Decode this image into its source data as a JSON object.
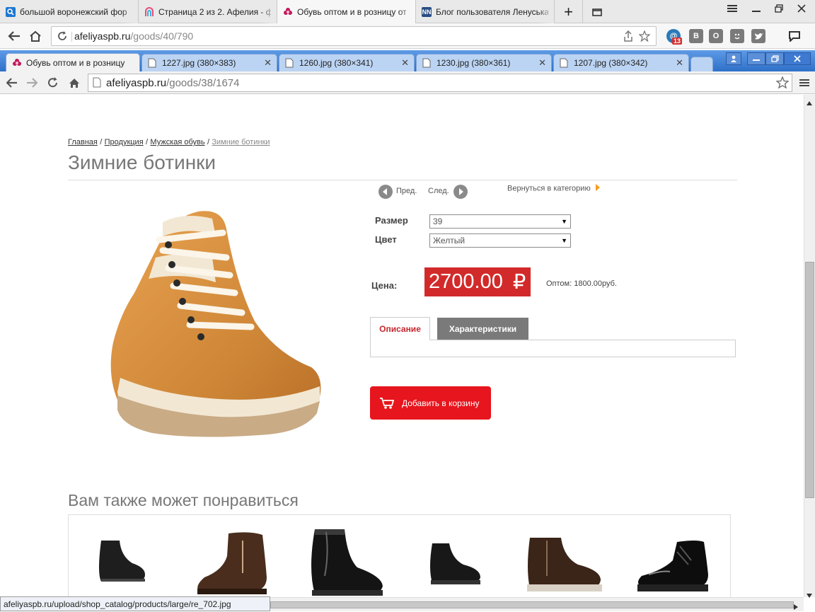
{
  "outer_browser": {
    "tabs": [
      {
        "title": "большой воронежский фор",
        "favicon_color": "#1f78d1"
      },
      {
        "title": "Страница 2 из 2. Афелия - ф",
        "favicon_color": "#e94e77"
      },
      {
        "title": "Обувь оптом и в розницу от",
        "favicon_color": "#c2185b"
      },
      {
        "title": "Блог пользователя Ленуська",
        "favicon_color": "#2a4d84",
        "favicon_text": "NN"
      }
    ],
    "new_tab_symbol": "+",
    "url_host": "afeliyaspb.ru",
    "url_path": "/goods/40/790",
    "badge_count": "13",
    "ext_letters": {
      "vk": "В",
      "ok": "О"
    }
  },
  "inner_browser": {
    "tabs": [
      {
        "title": "Обувь оптом и в розницу"
      },
      {
        "title": "1227.jpg (380×383)"
      },
      {
        "title": "1260.jpg (380×341)"
      },
      {
        "title": "1230.jpg (380×361)"
      },
      {
        "title": "1207.jpg (380×342)"
      }
    ],
    "url_host": "afeliyaspb.ru",
    "url_path": "/goods/38/1674"
  },
  "breadcrumb": {
    "items": [
      "Главная",
      "Продукция",
      "Мужская обувь"
    ],
    "current": "Зимние ботинки",
    "separator": "/"
  },
  "product": {
    "title": "Зимние ботинки",
    "prev_label": "Пред.",
    "next_label": "След.",
    "back_label": "Вернуться в категорию",
    "size_label": "Размер",
    "size_value": "39",
    "color_label": "Цвет",
    "color_value": "Желтый",
    "price_label": "Цена:",
    "price_value": "2700.00",
    "currency": "₽",
    "wholesale": "Оптом: 1800.00руб.",
    "tab_description": "Описание",
    "tab_specs": "Характеристики",
    "add_to_cart": "Добавить в корзину"
  },
  "recommend": {
    "title": "Вам также может понравиться"
  },
  "status_url": "afeliyaspb.ru/upload/shop_catalog/products/large/re_702.jpg",
  "colors": {
    "price_bg": "#d22a2a",
    "cart_btn": "#e7151d",
    "active_tab_text": "#c4262b",
    "inactive_tab_bg": "#7a7a7a",
    "inner_tabbar": "#2f70c9"
  }
}
